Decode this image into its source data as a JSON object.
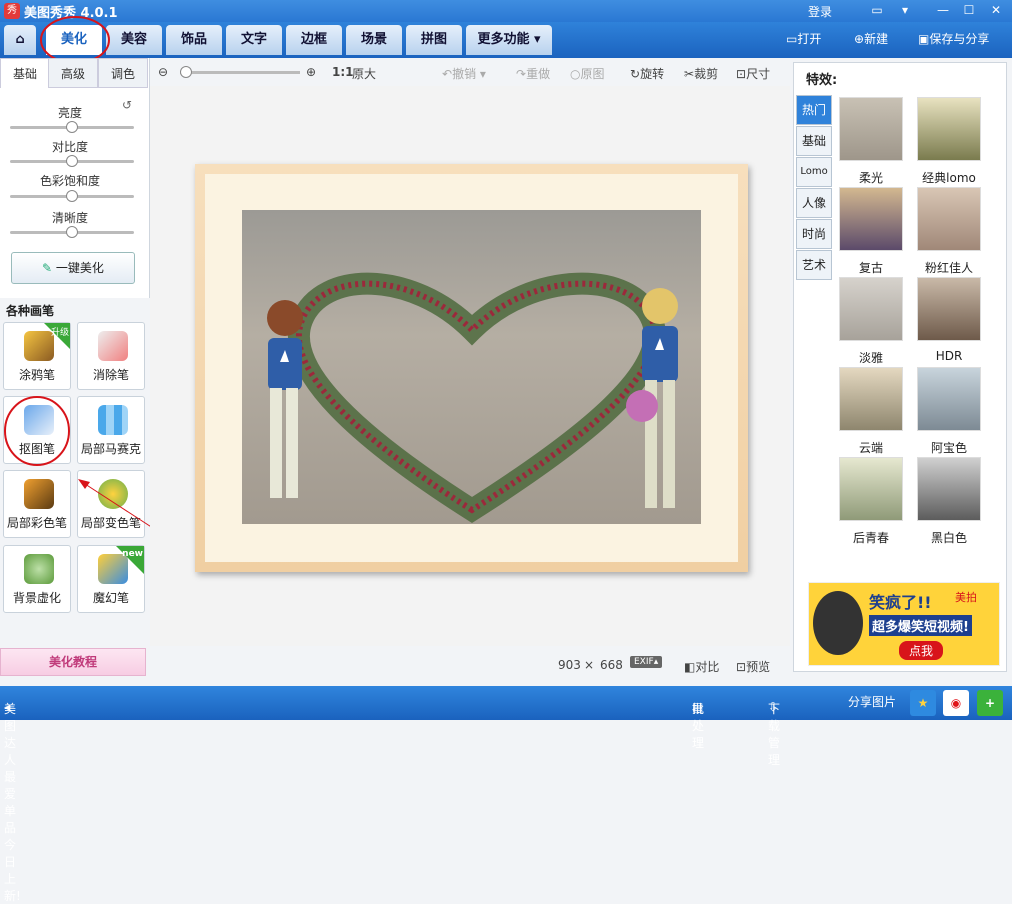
{
  "app": {
    "title": "美图秀秀 4.0.1",
    "icon_text": "秀",
    "login": "登录"
  },
  "tabs": [
    {
      "label": "美化"
    },
    {
      "label": "美容"
    },
    {
      "label": "饰品"
    },
    {
      "label": "文字"
    },
    {
      "label": "边框"
    },
    {
      "label": "场景"
    },
    {
      "label": "拼图"
    },
    {
      "label": "更多功能"
    }
  ],
  "header_actions": {
    "open": "打开",
    "new": "新建",
    "save": "保存与分享"
  },
  "toolbar": {
    "ratio": "1:1",
    "original_size": "原大",
    "undo": "撤销",
    "redo": "重做",
    "original": "原图",
    "rotate": "旋转",
    "crop": "裁剪",
    "resize": "尺寸",
    "zoom_level": 0.02
  },
  "left_tabs": [
    {
      "label": "基础"
    },
    {
      "label": "高级"
    },
    {
      "label": "调色"
    }
  ],
  "sliders": [
    {
      "label": "亮度",
      "level": 0.5
    },
    {
      "label": "对比度",
      "level": 0.5
    },
    {
      "label": "色彩饱和度",
      "level": 0.5
    },
    {
      "label": "清晰度",
      "level": 0.5
    }
  ],
  "one_key": "一键美化",
  "brushes_title": "各种画笔",
  "brushes": [
    {
      "label": "涂鸦笔",
      "badge": "升级"
    },
    {
      "label": "消除笔"
    },
    {
      "label": "抠图笔"
    },
    {
      "label": "局部马赛克"
    },
    {
      "label": "局部彩色笔"
    },
    {
      "label": "局部变色笔"
    },
    {
      "label": "背景虚化"
    },
    {
      "label": "魔幻笔",
      "badge": "new"
    }
  ],
  "tutorial": "美化教程",
  "image_info": {
    "width": "903",
    "x": "×",
    "height": "668",
    "exif": "EXIF",
    "compare": "对比",
    "preview": "预览"
  },
  "effects": {
    "title": "特效:",
    "tabs": [
      {
        "label": "热门"
      },
      {
        "label": "基础"
      },
      {
        "label": "Lomo"
      },
      {
        "label": "人像"
      },
      {
        "label": "时尚"
      },
      {
        "label": "艺术"
      }
    ],
    "items": [
      {
        "label": "柔光"
      },
      {
        "label": "经典lomo"
      },
      {
        "label": "复古"
      },
      {
        "label": "粉红佳人"
      },
      {
        "label": "淡雅"
      },
      {
        "label": "HDR"
      },
      {
        "label": "云端"
      },
      {
        "label": "阿宝色"
      },
      {
        "label": "后青春"
      },
      {
        "label": "黑白色"
      }
    ]
  },
  "ad": {
    "brand": "美拍",
    "line1": "笑疯了!!",
    "line2": "超多爆笑短视频!",
    "cta": "点我"
  },
  "status": {
    "news": "美图达人最爱单品今日上新!",
    "batch": "批处理",
    "download": "下载管理",
    "share": "分享图片"
  },
  "colors": {
    "accent": "#1b63bf",
    "annotation": "#d8141a"
  }
}
